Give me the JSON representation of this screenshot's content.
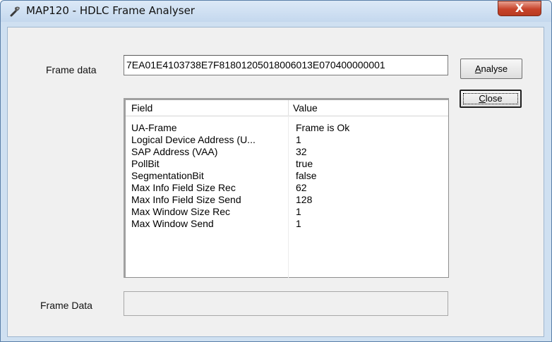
{
  "window": {
    "title": "MAP120 - HDLC Frame Analyser",
    "close_glyph": "X",
    "icon": "map120-app-icon"
  },
  "form": {
    "frame_data_label": "Frame data",
    "frame_data_value": "7EA01E4103738E7F81801205018006013E070400000001",
    "analyse_label_access": "A",
    "analyse_label_rest": "nalyse",
    "close_label_access": "C",
    "close_label_rest": "lose",
    "frame_data2_label": "Frame Data",
    "frame_data2_value": ""
  },
  "table": {
    "columns": [
      "Field",
      "Value"
    ],
    "rows": [
      {
        "field": "UA-Frame",
        "value": "Frame is Ok"
      },
      {
        "field": "Logical Device Address (U...",
        "value": "1"
      },
      {
        "field": "SAP Address (VAA)",
        "value": "32"
      },
      {
        "field": "PollBit",
        "value": "true"
      },
      {
        "field": "SegmentationBit",
        "value": "false"
      },
      {
        "field": "Max Info Field Size Rec",
        "value": "62"
      },
      {
        "field": "Max Info Field Size Send",
        "value": "128"
      },
      {
        "field": "Max Window Size Rec",
        "value": "1"
      },
      {
        "field": "Max Window Send",
        "value": "1"
      }
    ]
  }
}
